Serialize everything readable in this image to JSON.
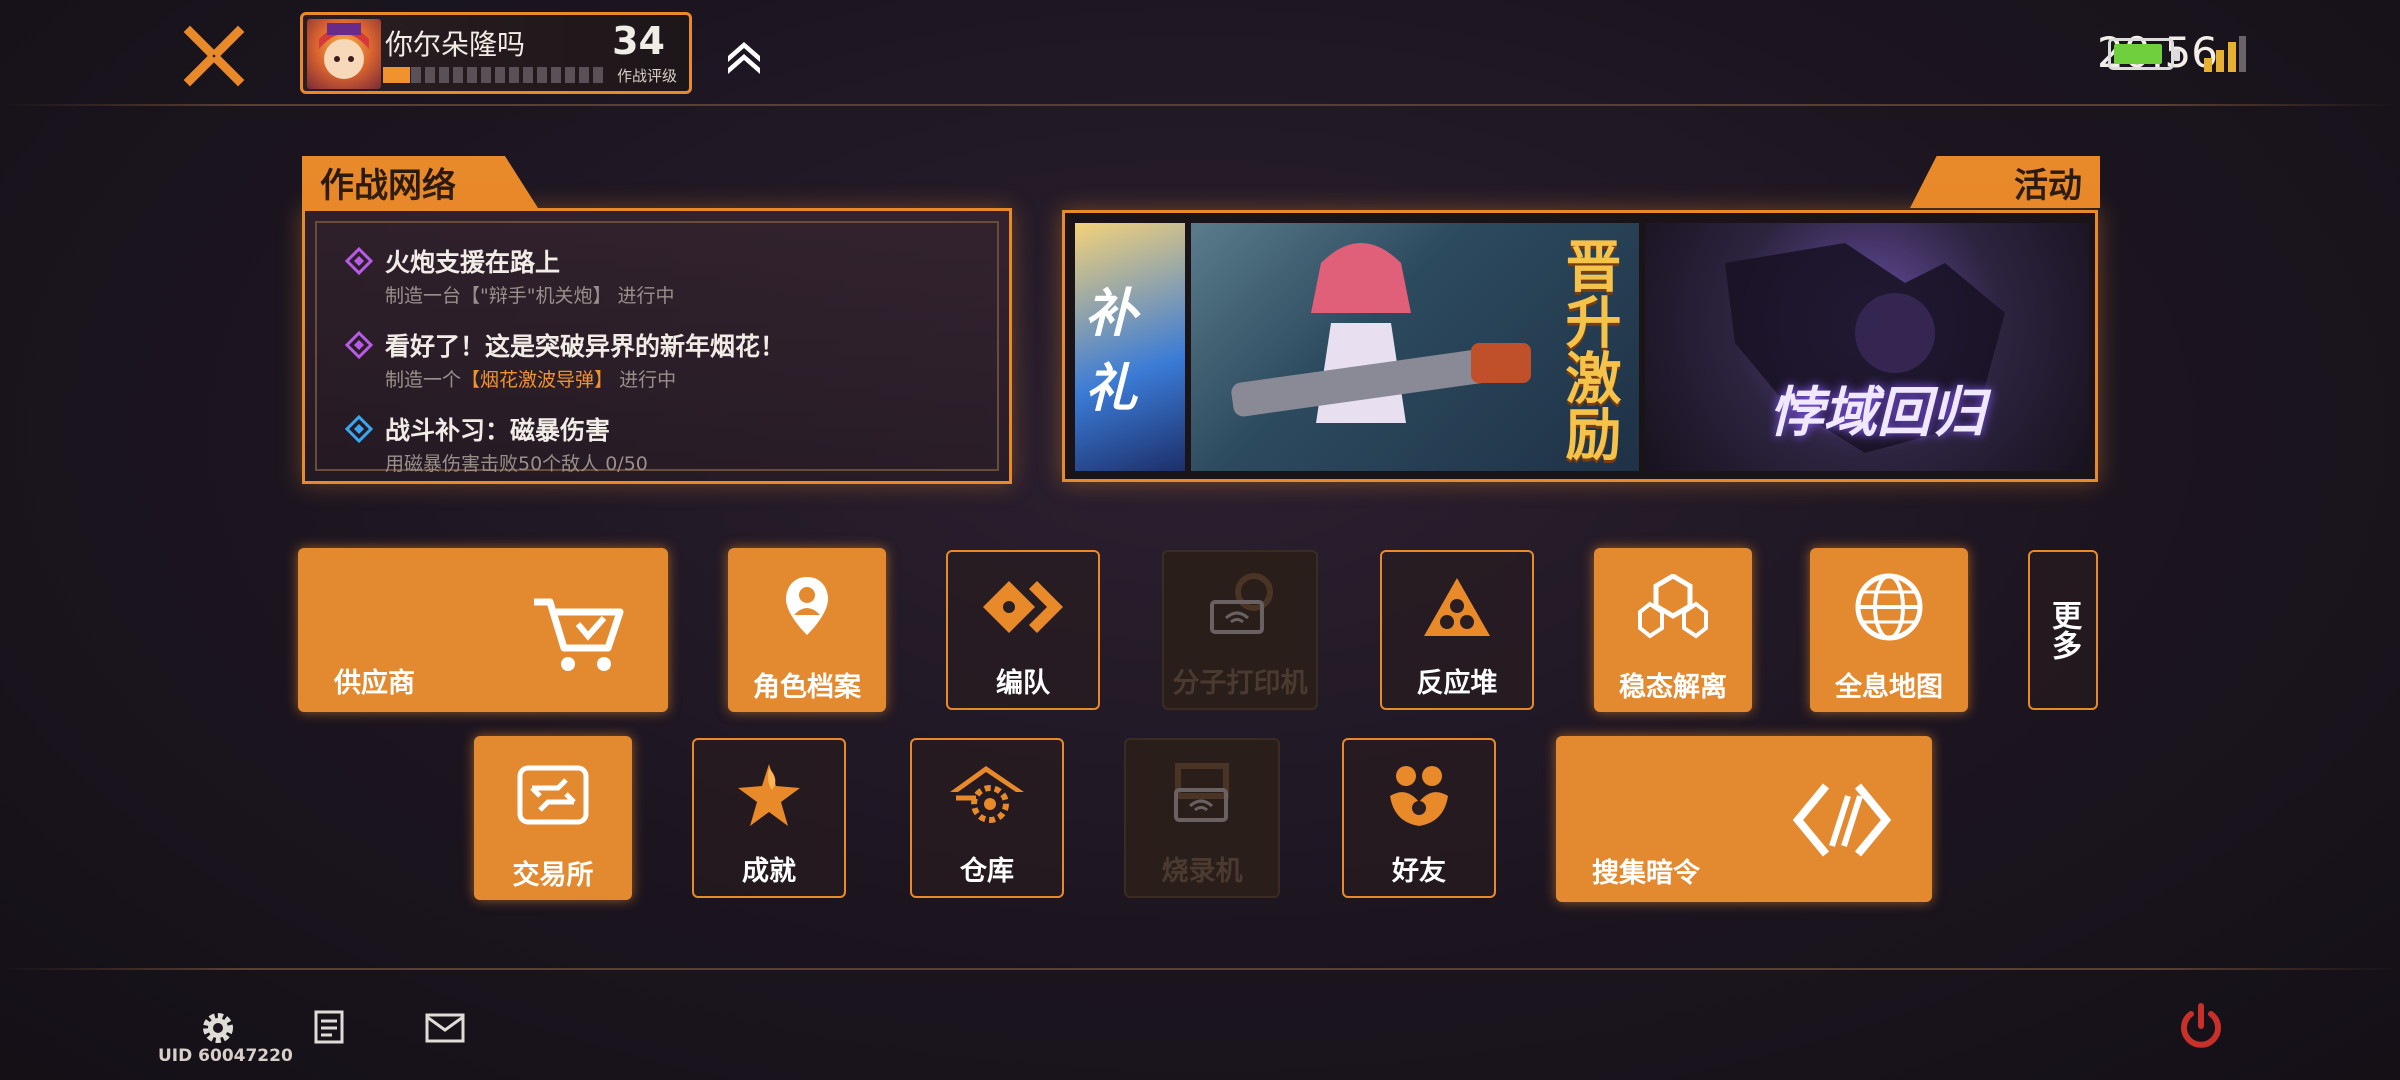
{
  "header": {
    "player_name": "你尔朵隆吗",
    "level": "34",
    "level_caption": "作战评级",
    "xp_progress": 0.12,
    "time": "20:56",
    "battery_level": 0.9
  },
  "missions": {
    "tab_label": "作战网络",
    "items": [
      {
        "title": "火炮支援在路上",
        "desc_prefix": "制造一台【\"辩手\"机关炮】 进行中",
        "desc_highlight": "",
        "desc_suffix": "",
        "icon": "diamond-target-icon"
      },
      {
        "title": "看好了！这是突破异界的新年烟花！",
        "desc_prefix": "制造一个",
        "desc_highlight": "【烟花激波导弹】",
        "desc_suffix": " 进行中",
        "icon": "diamond-target-icon"
      },
      {
        "title": "战斗补习：磁暴伤害",
        "desc_prefix": "用磁暴伤害击败50个敌人 0/50",
        "desc_highlight": "",
        "desc_suffix": "",
        "icon": "diamond-target-icon"
      }
    ]
  },
  "events": {
    "tab_label": "活动",
    "banners": [
      {
        "text": "补礼"
      },
      {
        "text": "晋升激励"
      },
      {
        "text": "悖域回归"
      }
    ]
  },
  "menu": {
    "row1": [
      {
        "label": "供应商",
        "icon": "cart-icon"
      },
      {
        "label": "角色档案",
        "icon": "profile-pin-icon"
      },
      {
        "label": "编队",
        "icon": "squad-icon"
      },
      {
        "label": "分子打印机",
        "icon": "printer-locked-icon"
      },
      {
        "label": "反应堆",
        "icon": "reactor-icon"
      },
      {
        "label": "稳态解离",
        "icon": "dissociation-icon"
      },
      {
        "label": "全息地图",
        "icon": "globe-icon"
      },
      {
        "label": "更多",
        "icon": ""
      }
    ],
    "row2": [
      {
        "label": "交易所",
        "icon": "exchange-icon"
      },
      {
        "label": "成就",
        "icon": "star-flame-icon"
      },
      {
        "label": "仓库",
        "icon": "warehouse-icon"
      },
      {
        "label": "烧录机",
        "icon": "burner-locked-icon"
      },
      {
        "label": "好友",
        "icon": "friends-icon"
      },
      {
        "label": "搜集暗令",
        "icon": "cipher-icon"
      }
    ]
  },
  "footer": {
    "uid": "UID 60047220"
  },
  "colors": {
    "accent": "#e8892a",
    "background": "#1c1520",
    "disabled": "#2a1e1a"
  }
}
